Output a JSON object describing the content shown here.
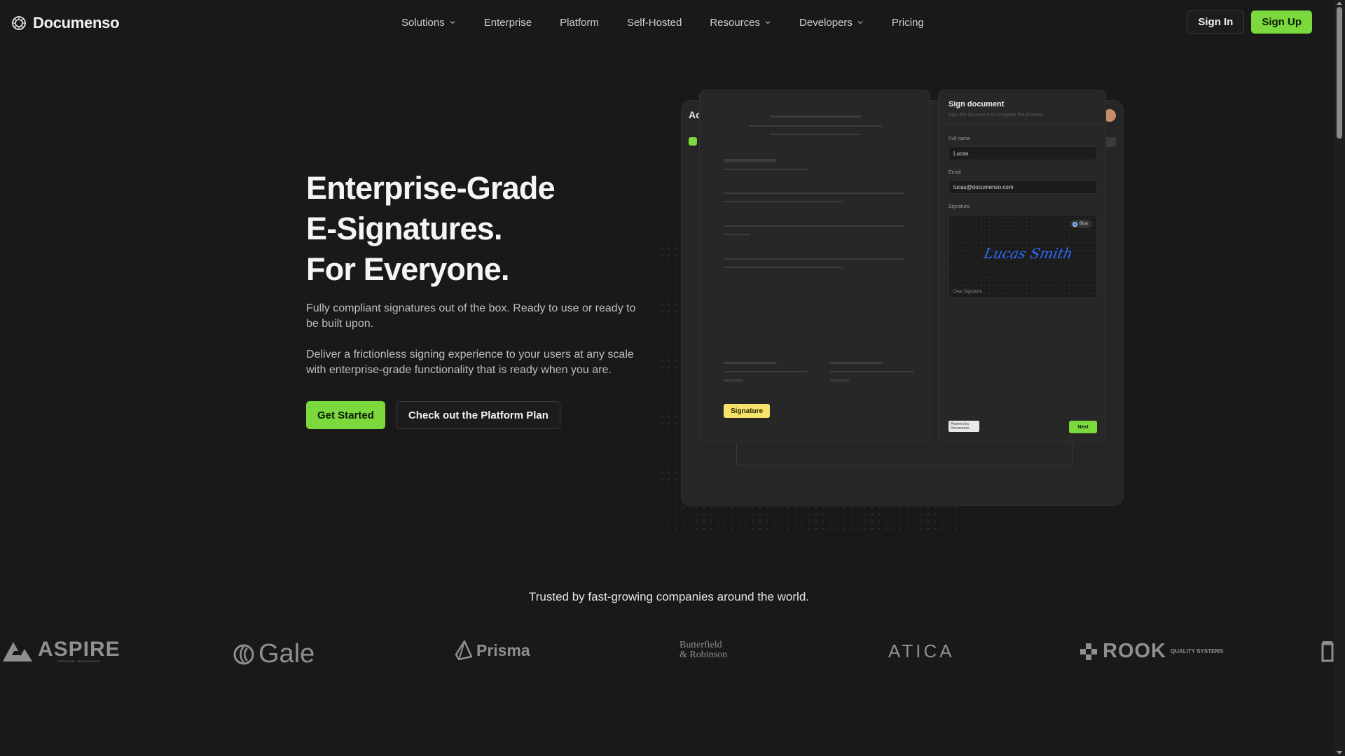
{
  "nav": {
    "brand": "Documenso",
    "menu": [
      {
        "label": "Solutions",
        "dropdown": true
      },
      {
        "label": "Enterprise",
        "dropdown": false
      },
      {
        "label": "Platform",
        "dropdown": false
      },
      {
        "label": "Self-Hosted",
        "dropdown": false
      },
      {
        "label": "Resources",
        "dropdown": true
      },
      {
        "label": "Developers",
        "dropdown": true
      },
      {
        "label": "Pricing",
        "dropdown": false
      }
    ],
    "sign_in": "Sign In",
    "sign_up": "Sign Up"
  },
  "hero": {
    "title_line1": "Enterprise-Grade",
    "title_line2": "E-Signatures.",
    "title_line3": "For Everyone.",
    "paragraph1": "Fully compliant signatures out of the box. Ready to use or ready to be built upon.",
    "paragraph2": "Deliver a frictionless signing experience to your users at any scale with enterprise-grade functionality that is ready when you are.",
    "cta_primary": "Get Started",
    "cta_secondary": "Check out the Platform Plan"
  },
  "mockup": {
    "back_title": "Ac",
    "document_tag": "Signature",
    "sign_panel": {
      "title": "Sign document",
      "subtitle": "Sign the document to complete the process.",
      "full_name_label": "Full name",
      "full_name_value": "Lucas",
      "email_label": "Email",
      "email_value": "lucas@documenso.com",
      "signature_label": "Signature",
      "signature_text": "Lucas Smith",
      "color_option": "Blue",
      "clear_label": "Clear Signature",
      "powered_by": "Powered by Documenso",
      "next_label": "Next"
    }
  },
  "trusted": {
    "heading": "Trusted by fast-growing companies around the world.",
    "brands": [
      {
        "name": "ASPIRE",
        "sub": "GENERAL INSURANCE"
      },
      {
        "name": "Gale"
      },
      {
        "name": "Prisma"
      },
      {
        "name": "Butterfield",
        "sub": "& Robinson"
      },
      {
        "name": "ATICA"
      },
      {
        "name": "ROOK",
        "sub": "QUALITY SYSTEMS"
      }
    ]
  },
  "colors": {
    "background": "#191919",
    "accent_green": "#7bd93d",
    "signature_blue": "#2f6bff",
    "tag_yellow": "#f7e36b"
  }
}
